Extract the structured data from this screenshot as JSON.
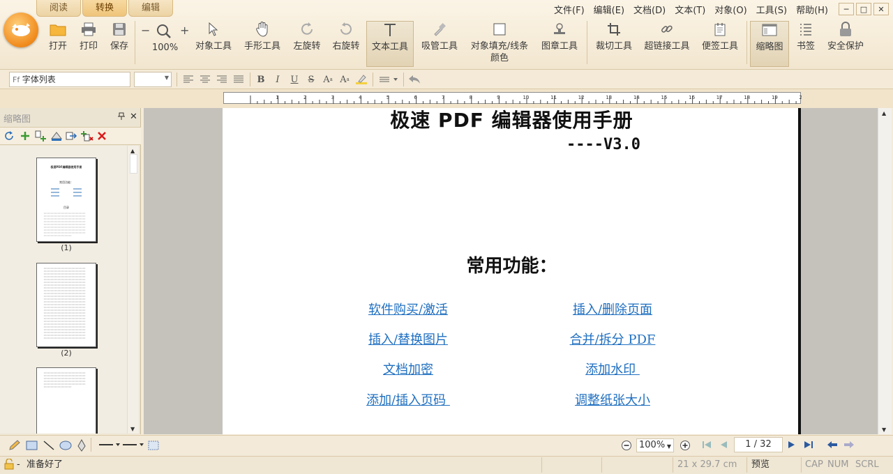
{
  "tabs": [
    "阅读",
    "转换",
    "编辑"
  ],
  "menu": [
    "文件(F)",
    "编辑(E)",
    "文档(D)",
    "文本(T)",
    "对象(O)",
    "工具(S)",
    "帮助(H)"
  ],
  "window_controls": {
    "minimize": "─",
    "maximize": "□",
    "close": "✕"
  },
  "toolbar": {
    "open": "打开",
    "print": "打印",
    "save": "保存",
    "zoom_out": "−",
    "zoom_in": "+",
    "zoom_value": "100%",
    "object_tool": "对象工具",
    "hand_tool": "手形工具",
    "rotate_left": "左旋转",
    "rotate_right": "右旋转",
    "text_tool": "文本工具",
    "eyedropper": "吸管工具",
    "fill_line_color_1": "对象填充/线条",
    "fill_line_color_2": "颜色",
    "stamp_tool": "图章工具",
    "crop_tool": "裁切工具",
    "link_tool": "超链接工具",
    "note_tool": "便签工具",
    "thumbnail": "缩略图",
    "bookmark": "书签",
    "security": "安全保护"
  },
  "format": {
    "font_list_placeholder": "字体列表",
    "bold": "B",
    "italic": "I",
    "underline": "U",
    "strike": "S",
    "superscript": "A",
    "subscript": "A"
  },
  "ruler_ticks": [
    "1",
    "2",
    "3",
    "4",
    "5",
    "6",
    "7",
    "8",
    "9",
    "10",
    "11",
    "12",
    "13",
    "14",
    "15",
    "16",
    "17",
    "18",
    "19",
    "20"
  ],
  "panel": {
    "title": "缩略图",
    "pin": "ᵖ",
    "close": "✕",
    "thumbs": [
      {
        "label": "(1)"
      },
      {
        "label": "(2)"
      }
    ],
    "thumb1_title": "极速PDF编辑器使用手册",
    "thumb1_section": "常用功能：",
    "thumb1_toc": "目录"
  },
  "document": {
    "title": "极速 PDF 编辑器使用手册",
    "version": "----V3.0",
    "section_heading": "常用功能：",
    "links": [
      {
        "left": "软件购买/激活",
        "right": "插入/删除页面"
      },
      {
        "left": "插入/替换图片",
        "right": "合并/拆分 PDF"
      },
      {
        "left": "文档加密",
        "right": "添加水印 "
      },
      {
        "left": "添加/插入页码 ",
        "right": "调整纸张大小"
      }
    ]
  },
  "bottom": {
    "zoom": "100%",
    "page_indicator": "1 / 32"
  },
  "status": {
    "ready": "准备好了",
    "paper_size": "21 x 29.7 cm",
    "mode": "预览",
    "cap": "CAP",
    "num": "NUM",
    "scrl": "SCRL"
  },
  "colors": {
    "ribbon": "#f6ecd8",
    "link": "#1f6fc0",
    "accent": "#f08a1c"
  }
}
